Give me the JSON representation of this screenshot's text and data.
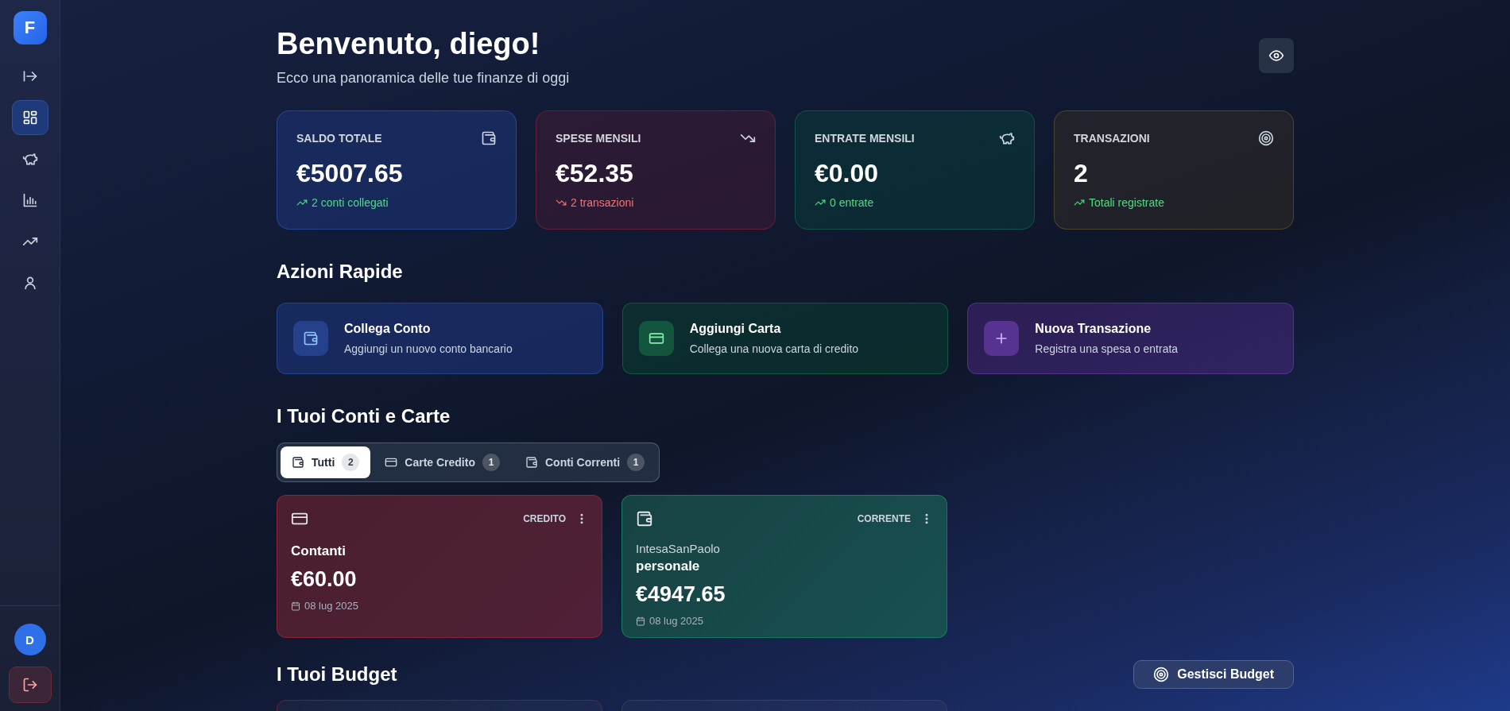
{
  "sidebar": {
    "logo": "F",
    "items": [
      {
        "kind": "expand",
        "selected": false
      },
      {
        "kind": "dashboard",
        "selected": true
      },
      {
        "kind": "savings",
        "selected": false
      },
      {
        "kind": "reports",
        "selected": false
      },
      {
        "kind": "trends",
        "selected": false
      },
      {
        "kind": "profile",
        "selected": false
      }
    ],
    "avatar": "D"
  },
  "header": {
    "title": "Benvenuto, diego!",
    "subtitle": "Ecco una panoramica delle tue finanze di oggi"
  },
  "stats": [
    {
      "kind": "balance",
      "label": "SALDO TOTALE",
      "value": "€5007.65",
      "note": "2 conti collegati",
      "rising": true
    },
    {
      "kind": "expense",
      "label": "SPESE MENSILI",
      "value": "€52.35",
      "note": "2 transazioni",
      "rising": false
    },
    {
      "kind": "income",
      "label": "ENTRATE MENSILI",
      "value": "€0.00",
      "note": "0 entrate",
      "rising": true
    },
    {
      "kind": "count",
      "label": "TRANSAZIONI",
      "value": "2",
      "note": "Totali registrate",
      "rising": true
    }
  ],
  "quick_actions": {
    "title": "Azioni Rapide",
    "items": [
      {
        "kind": "account",
        "title": "Collega Conto",
        "description": "Aggiungi un nuovo conto bancario"
      },
      {
        "kind": "card",
        "title": "Aggiungi Carta",
        "description": "Collega una nuova carta di credito"
      },
      {
        "kind": "transaction",
        "title": "Nuova Transazione",
        "description": "Registra una spesa o entrata"
      }
    ]
  },
  "accounts": {
    "title": "I Tuoi Conti e Carte",
    "tabs": [
      {
        "kind": "all",
        "label": "Tutti",
        "count": "2",
        "selected": true
      },
      {
        "kind": "card",
        "label": "Carte Credito",
        "count": "1",
        "selected": false
      },
      {
        "kind": "account",
        "label": "Conti Correnti",
        "count": "1",
        "selected": false
      }
    ],
    "items": [
      {
        "kind": "credit",
        "type": "CREDITO",
        "name": "Contanti",
        "amount": "€60.00",
        "date": "08 lug 2025"
      },
      {
        "kind": "current",
        "type": "CORRENTE",
        "bank": "IntesaSanPaolo",
        "name": "personale",
        "amount": "€4947.65",
        "date": "08 lug 2025"
      }
    ]
  },
  "budgets": {
    "title": "I Tuoi Budget",
    "button": "Gestisci Budget",
    "items": [
      {
        "color": "#6b2238"
      },
      {
        "color": "#3a4150"
      }
    ]
  }
}
